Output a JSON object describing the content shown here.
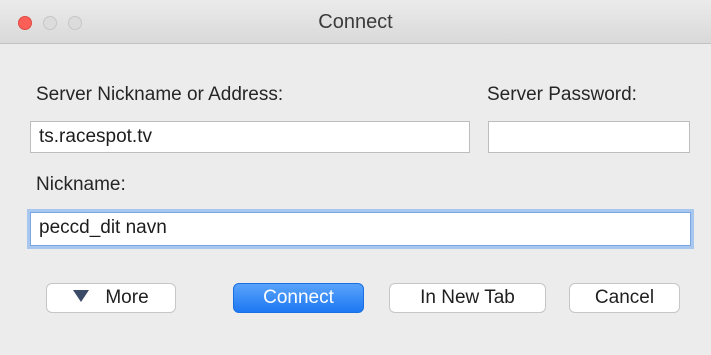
{
  "window": {
    "title": "Connect"
  },
  "form": {
    "server_label": "Server Nickname or Address:",
    "server_value": "ts.racespot.tv",
    "password_label": "Server Password:",
    "password_value": "",
    "nickname_label": "Nickname:",
    "nickname_value": "peccd_dit navn"
  },
  "buttons": {
    "more_label": "More",
    "connect_label": "Connect",
    "new_tab_label": "In New Tab",
    "cancel_label": "Cancel"
  },
  "colors": {
    "accent": "#1d78f2",
    "close": "#fc5f57",
    "focus_ring": "#a8c7ef"
  },
  "icons": {
    "more_icon": "triangle-down-icon"
  }
}
